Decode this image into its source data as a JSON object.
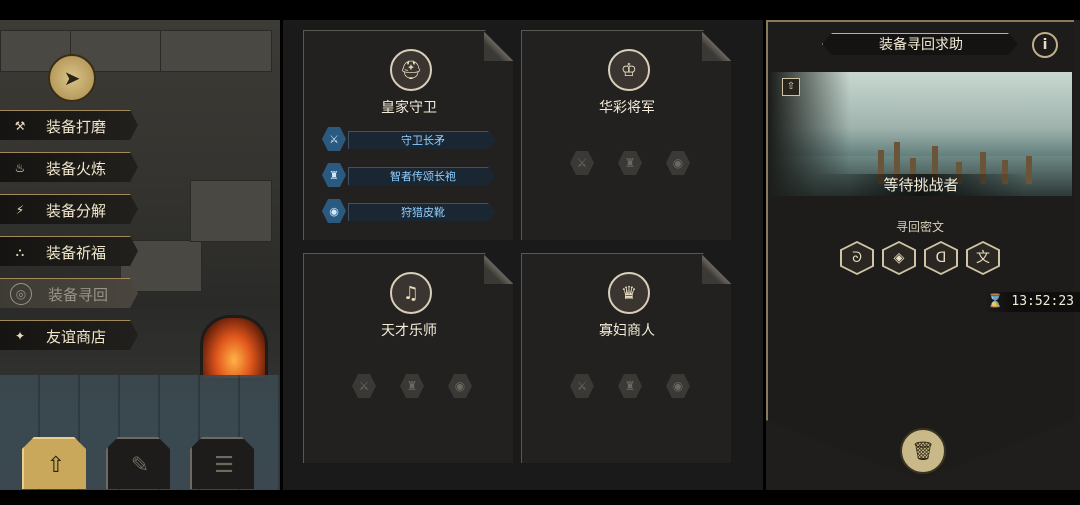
{
  "menu": {
    "items": [
      {
        "label": "装备打磨",
        "icon": "hammer-icon",
        "glyph": "⚒",
        "active": false
      },
      {
        "label": "装备火炼",
        "icon": "flame-icon",
        "glyph": "♨",
        "active": false
      },
      {
        "label": "装备分解",
        "icon": "disassemble-icon",
        "glyph": "⚡",
        "active": false
      },
      {
        "label": "装备祈福",
        "icon": "pray-icon",
        "glyph": "⛬",
        "active": false
      },
      {
        "label": "装备寻回",
        "icon": "target-icon",
        "glyph": "◎",
        "active": true
      },
      {
        "label": "友谊商店",
        "icon": "fox-icon",
        "glyph": "✦",
        "active": false
      }
    ]
  },
  "bottom_tabs": [
    {
      "icon": "upload-icon",
      "glyph": "⇧",
      "active": true
    },
    {
      "icon": "quill-icon",
      "glyph": "✎",
      "active": false
    },
    {
      "icon": "list-icon",
      "glyph": "☰",
      "active": false
    }
  ],
  "cards": [
    {
      "name": "皇家守卫",
      "portrait_icon": "knight-helmet-icon",
      "portrait_glyph": "⛑",
      "equipment": [
        {
          "label": "守卫长矛",
          "icon": "spear-icon",
          "glyph": "⚔"
        },
        {
          "label": "智者传颂长袍",
          "icon": "robe-icon",
          "glyph": "♜"
        },
        {
          "label": "狩猎皮靴",
          "icon": "boot-icon",
          "glyph": "◉"
        }
      ]
    },
    {
      "name": "华彩将军",
      "portrait_icon": "general-portrait-icon",
      "portrait_glyph": "♔",
      "slots": [
        "weapon-slot-icon",
        "armor-slot-icon",
        "accessory-slot-icon"
      ]
    },
    {
      "name": "天才乐师",
      "portrait_icon": "musician-portrait-icon",
      "portrait_glyph": "♫",
      "slots": [
        "weapon-slot-icon",
        "armor-slot-icon",
        "accessory-slot-icon"
      ]
    },
    {
      "name": "寡妇商人",
      "portrait_icon": "merchant-portrait-icon",
      "portrait_glyph": "♛",
      "slots": [
        "weapon-slot-icon",
        "armor-slot-icon",
        "accessory-slot-icon"
      ]
    }
  ],
  "right_panel": {
    "title": "装备寻回求助",
    "info": "i",
    "banner_title": "等待挑战者",
    "cipher_label": "寻回密文",
    "cipher_glyphs": [
      "ᘐ",
      "◈",
      "ᗡ",
      "文"
    ],
    "timer": "13:52:23"
  },
  "colors": {
    "accent_gold": "#c9a85c",
    "equip_blue": "#8fd0ff",
    "panel_bg": "#1d1c1a"
  }
}
